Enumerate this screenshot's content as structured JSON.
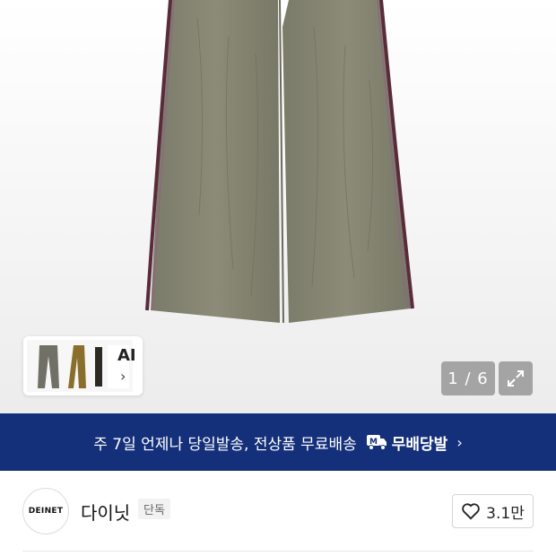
{
  "gallery": {
    "counter": "1 / 6",
    "ai_label": "AI",
    "ai_chevron": "›",
    "expand_icon": "expand-icon"
  },
  "banner": {
    "text": "주 7일 언제나 당일발송, 전상품 무료배송",
    "brand": "무배당발",
    "brand_icon": "delivery-truck-icon",
    "chevron": "›",
    "background": "#15307a"
  },
  "brand": {
    "logo_text": "DEINET",
    "name": "다이닛",
    "badge": "단독",
    "likes": "3.1만",
    "like_icon": "heart-icon"
  }
}
